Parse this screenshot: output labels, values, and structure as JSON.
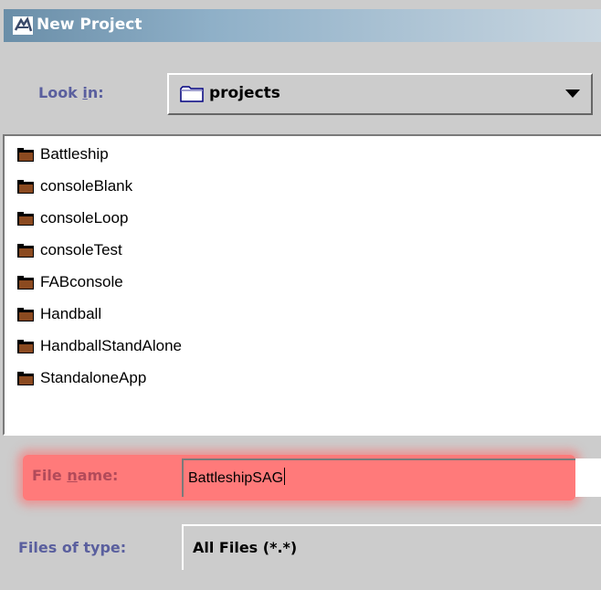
{
  "window": {
    "title": "New Project",
    "title_icon": "app-icon"
  },
  "look_in": {
    "label_pre": "Look ",
    "label_mnemonic": "i",
    "label_post": "n:",
    "value": "projects",
    "icon": "folder-icon"
  },
  "files": [
    {
      "name": "Battleship",
      "icon": "folder-icon"
    },
    {
      "name": "consoleBlank",
      "icon": "folder-icon"
    },
    {
      "name": "consoleLoop",
      "icon": "folder-icon"
    },
    {
      "name": "consoleTest",
      "icon": "folder-icon"
    },
    {
      "name": "FABconsole",
      "icon": "folder-icon"
    },
    {
      "name": "Handball",
      "icon": "folder-icon"
    },
    {
      "name": "HandballStandAlone",
      "icon": "folder-icon"
    },
    {
      "name": "StandaloneApp",
      "icon": "folder-icon"
    }
  ],
  "file_name": {
    "label_pre": "File ",
    "label_mnemonic": "n",
    "label_post": "ame:",
    "value": "BattleshipSAG"
  },
  "files_of_type": {
    "label": "Files of type:",
    "value": "All Files (*.*)"
  },
  "colors": {
    "label": "#5a5f9e",
    "highlight": "#ff7a7a",
    "folder_brown": "#8b4a20",
    "title_start": "#6a8ea8"
  }
}
